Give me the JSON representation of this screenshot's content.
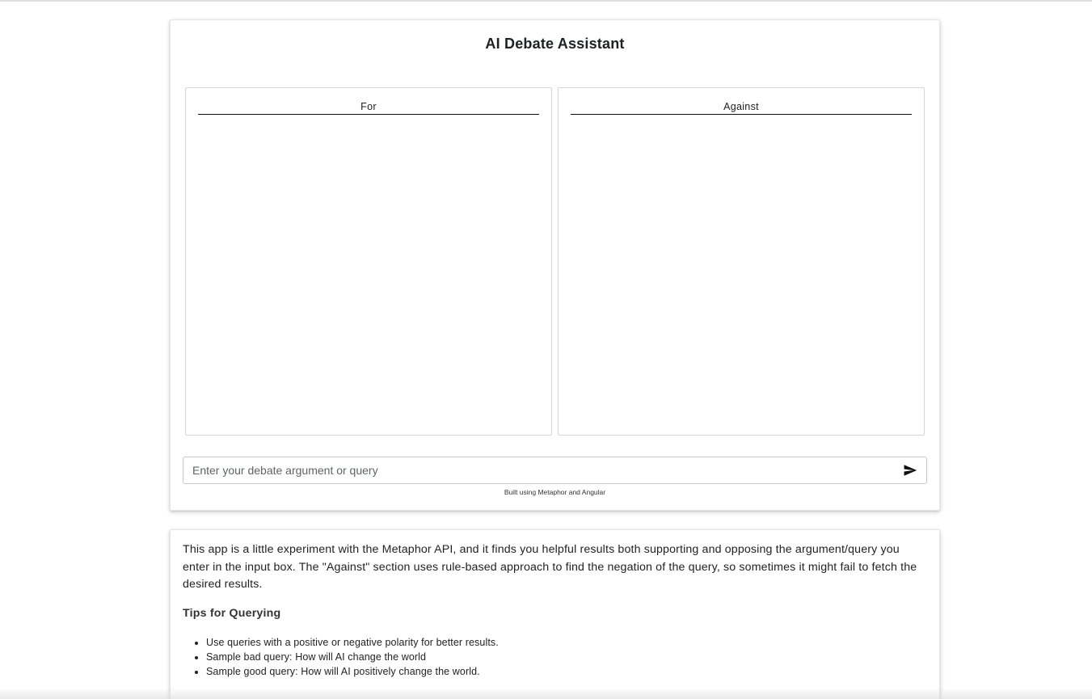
{
  "app": {
    "title": "AI Debate Assistant"
  },
  "panels": {
    "for_label": "For",
    "against_label": "Against"
  },
  "query": {
    "placeholder": "Enter your debate argument or query",
    "value": "",
    "send_icon": "send-icon"
  },
  "footer": {
    "built_with": "Built using Metaphor and Angular"
  },
  "info": {
    "description": "This app is a little experiment with the Metaphor API, and it finds you helpful results both supporting and opposing the argument/query you enter in the input box. The \"Against\" section uses rule-based approach to find the negation of the query, so sometimes it might fail to fetch the desired results.",
    "tips_title": "Tips for Querying",
    "tips": [
      "Use queries with a positive or negative polarity for better results.",
      "Sample bad query: How will AI change the world",
      "Sample good query: How will AI positively change the world."
    ]
  }
}
